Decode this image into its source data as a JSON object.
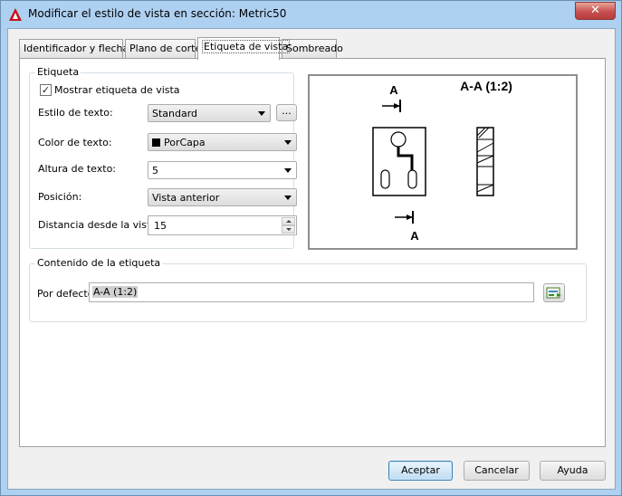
{
  "window": {
    "title": "Modificar el estilo de vista en sección: Metric50",
    "close_label": "✕"
  },
  "tabs": [
    {
      "label": "Identificador y flechas"
    },
    {
      "label": "Plano de corte"
    },
    {
      "label": "Etiqueta de vista"
    },
    {
      "label": "Sombreado"
    }
  ],
  "label_group": {
    "title": "Etiqueta",
    "show_label": {
      "label": "Mostrar etiqueta de vista",
      "checked": true
    },
    "text_style": {
      "label": "Estilo de texto:",
      "value": "Standard",
      "browse_label": "..."
    },
    "text_color": {
      "label": "Color de texto:",
      "value": "PorCapa",
      "swatch": "#000000"
    },
    "text_height": {
      "label": "Altura de texto:",
      "value": "5"
    },
    "position": {
      "label": "Posición:",
      "value": "Vista anterior"
    },
    "distance": {
      "label": "Distancia desde la vista:",
      "value": "15"
    }
  },
  "preview": {
    "section_letter_top": "A",
    "section_letter_bottom": "A",
    "view_label": "A-A (1:2)"
  },
  "content_group": {
    "title": "Contenido de la etiqueta",
    "default_label": "Por defecto:",
    "default_value": "A-A (1:2)",
    "edit_icon": "field-edit-icon"
  },
  "buttons": {
    "ok": "Aceptar",
    "cancel": "Cancelar",
    "help": "Ayuda"
  },
  "colors": {
    "title_bar": "#aed0f1",
    "close_button": "#c75050",
    "default_button_border": "#3c7fb1"
  }
}
